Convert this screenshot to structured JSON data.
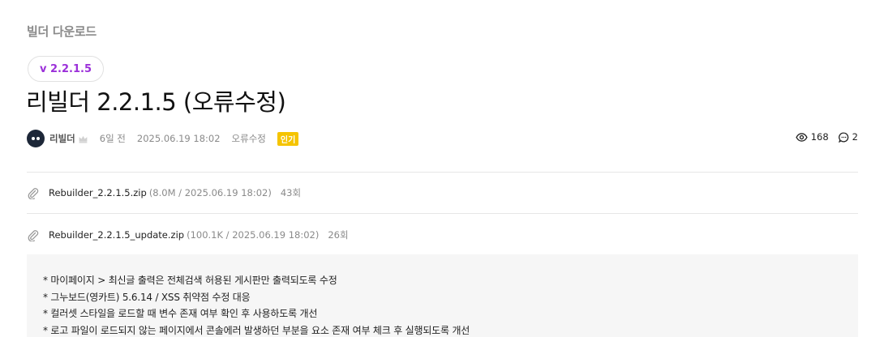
{
  "breadcrumb": {
    "category": "빌더 다운로드"
  },
  "post": {
    "version": "v 2.2.1.5",
    "title": "리빌더 2.2.1.5 (오류수정)",
    "author": "리빌더",
    "relative_time": "6일 전",
    "datetime": "2025.06.19 18:02",
    "tag": "오류수정",
    "hot_badge": "인기",
    "views": "168",
    "comments": "2"
  },
  "attachments": [
    {
      "name": "Rebuilder_2.2.1.5.zip",
      "meta": "(8.0M / 2025.06.19 18:02)",
      "count": "43회",
      "icon": "paperclip-icon"
    },
    {
      "name": "Rebuilder_2.2.1.5_update.zip",
      "meta": "(100.1K / 2025.06.19 18:02)",
      "count": "26회",
      "icon": "paperclip-icon"
    }
  ],
  "changelog": [
    "* 마이페이지 > 최신글 출력은 전체검색 허용된 게시판만 출력되도록 수정",
    "* 그누보드(영카트) 5.6.14 / XSS 취약점 수정 대응",
    "* 컬러셋 스타일을 로드할 때 변수 존재 여부 확인 후 사용하도록 개선",
    "* 로고 파일이 로드되지 않는 페이지에서 콘솔에러 발생하던 부분을 요소 존재 여부 체크 후 실행되도록 개선"
  ],
  "colors": {
    "version_accent": "#9b30d9",
    "hot_badge": "#f5c400",
    "avatar": "#1d2738"
  }
}
